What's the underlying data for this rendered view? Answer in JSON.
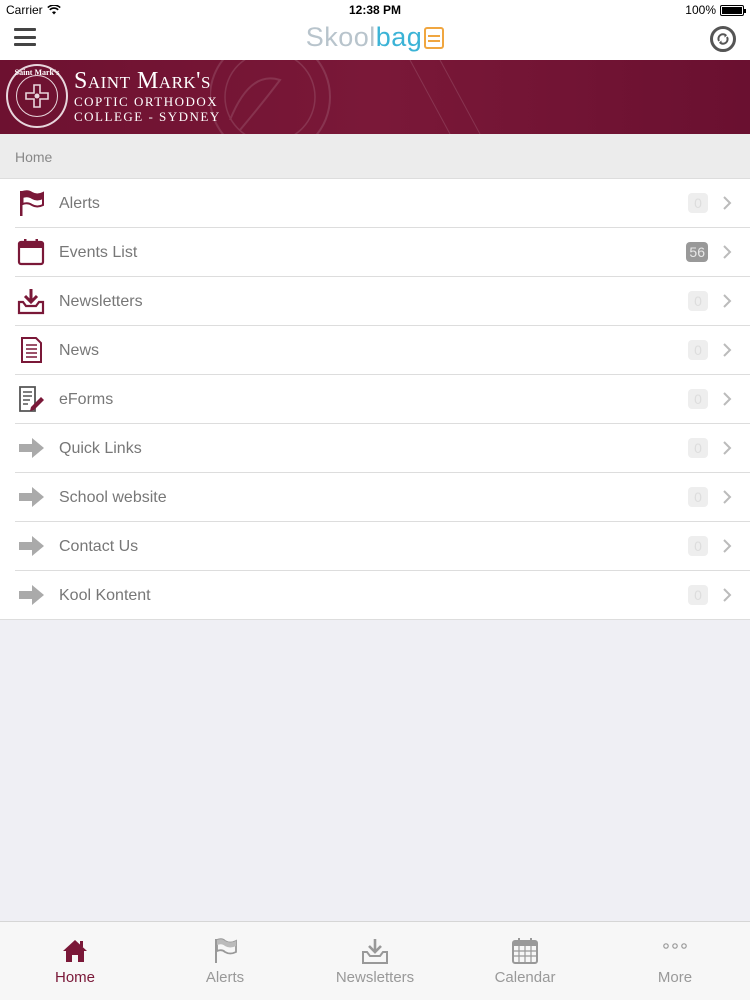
{
  "status_bar": {
    "carrier": "Carrier",
    "time": "12:38 PM",
    "battery": "100%"
  },
  "nav": {
    "logo_part1": "Skool",
    "logo_part2": "bag"
  },
  "banner": {
    "crest_text": "Saint Mark's",
    "line1": "Saint Mark's",
    "line2": "COPTIC ORTHODOX",
    "line3": "COLLEGE - SYDNEY"
  },
  "breadcrumb": "Home",
  "menu": [
    {
      "label": "Alerts",
      "badge": "0",
      "icon": "flag-icon"
    },
    {
      "label": "Events List",
      "badge": "56",
      "icon": "calendar-icon"
    },
    {
      "label": "Newsletters",
      "badge": "0",
      "icon": "inbox-download-icon"
    },
    {
      "label": "News",
      "badge": "0",
      "icon": "document-icon"
    },
    {
      "label": "eForms",
      "badge": "0",
      "icon": "form-pen-icon"
    },
    {
      "label": "Quick Links",
      "badge": "0",
      "icon": "arrow-right-icon"
    },
    {
      "label": "School website",
      "badge": "0",
      "icon": "arrow-right-icon"
    },
    {
      "label": "Contact Us",
      "badge": "0",
      "icon": "arrow-right-icon"
    },
    {
      "label": "Kool Kontent",
      "badge": "0",
      "icon": "arrow-right-icon"
    }
  ],
  "tabs": [
    {
      "label": "Home",
      "icon": "home-icon"
    },
    {
      "label": "Alerts",
      "icon": "flag-icon"
    },
    {
      "label": "Newsletters",
      "icon": "inbox-download-icon"
    },
    {
      "label": "Calendar",
      "icon": "calendar-grid-icon"
    },
    {
      "label": "More",
      "icon": "more-dots-icon"
    }
  ],
  "colors": {
    "brand": "#7a1838",
    "accent": "#3bb3d6",
    "logo_icon": "#f0a640"
  }
}
